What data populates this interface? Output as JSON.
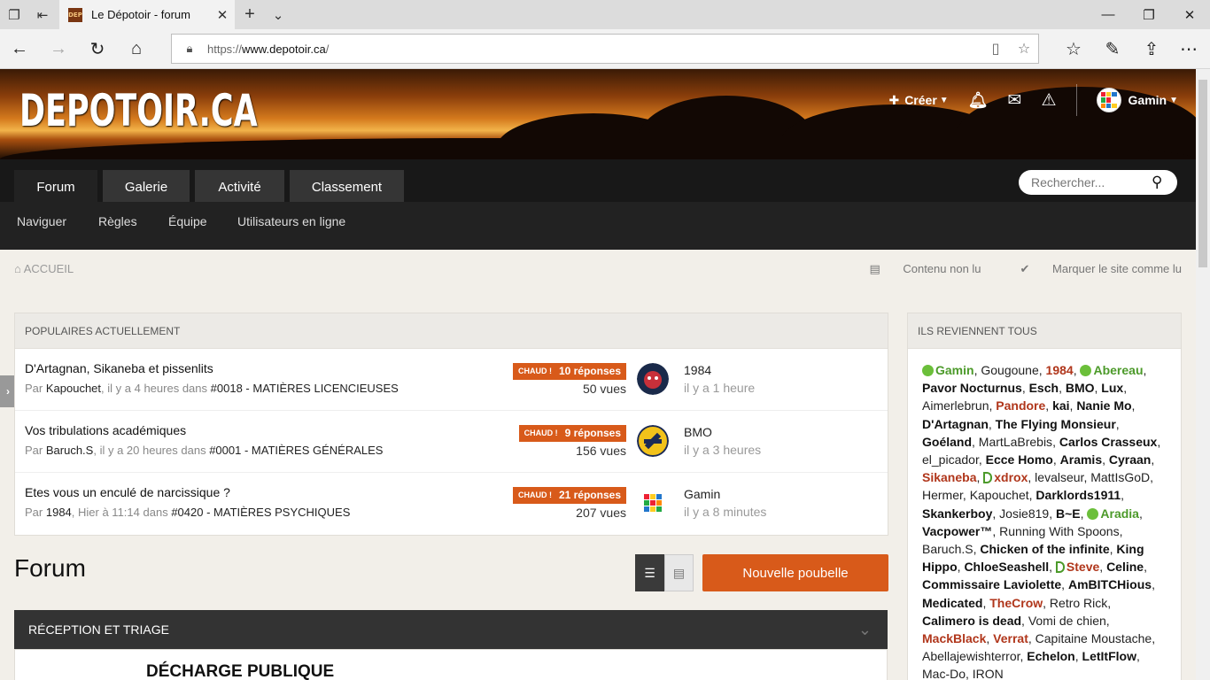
{
  "browser": {
    "tab_title": "Le Dépotoir - forum",
    "tab_favicon": "DEP",
    "url_prefix": "https://",
    "url_host": "www.depotoir.ca",
    "url_suffix": "/"
  },
  "site": {
    "logo": "DEPOTOIR.CA",
    "create_label": "Créer",
    "username": "Gamin",
    "search_placeholder": "Rechercher..."
  },
  "nav": {
    "tabs": [
      "Forum",
      "Galerie",
      "Activité",
      "Classement"
    ],
    "sub": [
      "Naviguer",
      "Règles",
      "Équipe",
      "Utilisateurs en ligne"
    ]
  },
  "breadcrumb": {
    "home": "ACCUEIL",
    "unread": "Contenu non lu",
    "mark_read": "Marquer le site comme lu"
  },
  "popular": {
    "heading": "POPULAIRES ACTUELLEMENT",
    "hot_label": "CHAUD !",
    "by": "Par",
    "in": "dans",
    "topics": [
      {
        "title": "D'Artagnan, Sikaneba et pissenlits",
        "author": "Kapouchet",
        "when": "il y a 4 heures",
        "forum": "#0018 - MATIÈRES LICENCIEUSES",
        "replies": "10 réponses",
        "views": "50 vues",
        "last_user": "1984",
        "last_time": "il y a 1 heure"
      },
      {
        "title": "Vos tribulations académiques",
        "author": "Baruch.S",
        "when": "il y a 20 heures",
        "forum": "#0001 - MATIÈRES GÉNÉRALES",
        "replies": "9 réponses",
        "views": "156 vues",
        "last_user": "BMO",
        "last_time": "il y a 3 heures"
      },
      {
        "title": "Etes vous un enculé de narcissique ?",
        "author": "1984",
        "when": "Hier à 11:14",
        "forum": "#0420 - MATIÈRES PSYCHIQUES",
        "replies": "21 réponses",
        "views": "207 vues",
        "last_user": "Gamin",
        "last_time": "il y a 8 minutes"
      }
    ]
  },
  "forum": {
    "title": "Forum",
    "new_button": "Nouvelle poubelle",
    "category": "RÉCEPTION ET TRIAGE",
    "first_forum": "DÉCHARGE PUBLIQUE"
  },
  "online": {
    "heading": "ILS REVIENNENT TOUS",
    "users": [
      {
        "n": "Gamin",
        "s": "g",
        "i": "dot"
      },
      {
        "n": "Gougoune",
        "s": "u"
      },
      {
        "n": "1984",
        "s": "r"
      },
      {
        "n": "Abereau",
        "s": "g",
        "i": "dot"
      },
      {
        "n": "Pavor Nocturnus",
        "s": "b"
      },
      {
        "n": "Esch",
        "s": "b"
      },
      {
        "n": "BMO",
        "s": "b"
      },
      {
        "n": "Lux",
        "s": "b"
      },
      {
        "n": "Aimerlebrun",
        "s": "u"
      },
      {
        "n": "Pandore",
        "s": "r"
      },
      {
        "n": "kai",
        "s": "b"
      },
      {
        "n": "Nanie Mo",
        "s": "b"
      },
      {
        "n": "D'Artagnan",
        "s": "b"
      },
      {
        "n": "The Flying Monsieur",
        "s": "b"
      },
      {
        "n": "Goéland",
        "s": "b"
      },
      {
        "n": "MartLaBrebis",
        "s": "u"
      },
      {
        "n": "Carlos Crasseux",
        "s": "b"
      },
      {
        "n": "el_picador",
        "s": "u"
      },
      {
        "n": "Ecce Homo",
        "s": "b"
      },
      {
        "n": "Aramis",
        "s": "b"
      },
      {
        "n": "Cyraan",
        "s": "b"
      },
      {
        "n": "Sikaneba",
        "s": "r"
      },
      {
        "n": "xdrox",
        "s": "r",
        "i": "d"
      },
      {
        "n": "levalseur",
        "s": "u"
      },
      {
        "n": "MattIsGoD",
        "s": "u"
      },
      {
        "n": "Hermer",
        "s": "u"
      },
      {
        "n": "Kapouchet",
        "s": "u"
      },
      {
        "n": "Darklords1911",
        "s": "b"
      },
      {
        "n": "Skankerboy",
        "s": "b"
      },
      {
        "n": "Josie819",
        "s": "u"
      },
      {
        "n": "B~E",
        "s": "b"
      },
      {
        "n": "Aradia",
        "s": "g",
        "i": "dot"
      },
      {
        "n": "Vacpower™",
        "s": "b"
      },
      {
        "n": "Running With Spoons",
        "s": "u"
      },
      {
        "n": "Baruch.S",
        "s": "u"
      },
      {
        "n": "Chicken of the infinite",
        "s": "b"
      },
      {
        "n": "King Hippo",
        "s": "b"
      },
      {
        "n": "ChloeSeashell",
        "s": "b"
      },
      {
        "n": "Steve",
        "s": "r",
        "i": "d"
      },
      {
        "n": "Celine",
        "s": "b"
      },
      {
        "n": "Commissaire Laviolette",
        "s": "b"
      },
      {
        "n": "AmBITCHious",
        "s": "b"
      },
      {
        "n": "Medicated",
        "s": "b"
      },
      {
        "n": "TheCrow",
        "s": "r"
      },
      {
        "n": "Retro Rick",
        "s": "u"
      },
      {
        "n": "Calimero is dead",
        "s": "b"
      },
      {
        "n": "Vomi de chien",
        "s": "u"
      },
      {
        "n": "MackBlack",
        "s": "r"
      },
      {
        "n": "Verrat",
        "s": "r"
      },
      {
        "n": "Capitaine Moustache",
        "s": "u"
      },
      {
        "n": "Abellajewishterror",
        "s": "u"
      },
      {
        "n": "Echelon",
        "s": "b"
      },
      {
        "n": "LetItFlow",
        "s": "b"
      },
      {
        "n": "Mac-Do",
        "s": "u"
      },
      {
        "n": "IRON",
        "s": "u"
      }
    ]
  },
  "colors": {
    "accent": "#d85a1a",
    "dark": "#222222",
    "hero_orange": "#d57a1d"
  }
}
